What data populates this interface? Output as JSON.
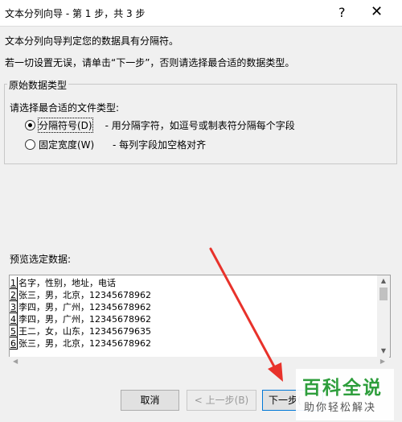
{
  "window": {
    "title": "文本分列向导 - 第 1 步，共 3 步",
    "help_label": "?",
    "close_label": "✕"
  },
  "description": {
    "line1": "文本分列向导判定您的数据具有分隔符。",
    "line2": "若一切设置无误，请单击“下一步”，否则请选择最合适的数据类型。"
  },
  "data_type_group": {
    "legend": "原始数据类型",
    "prompt": "请选择最合适的文件类型:",
    "options": [
      {
        "label": "分隔符号(D)",
        "desc": "- 用分隔字符，如逗号或制表符分隔每个字段",
        "checked": true
      },
      {
        "label": "固定宽度(W)",
        "desc": "- 每列字段加空格对齐",
        "checked": false
      }
    ]
  },
  "preview": {
    "label": "预览选定数据:",
    "rows": [
      {
        "num": "1",
        "text": "名字，性别，地址，电话"
      },
      {
        "num": "2",
        "text": "张三，男，北京，12345678962"
      },
      {
        "num": "3",
        "text": "李四，男，广州，12345678962"
      },
      {
        "num": "4",
        "text": "李四，男，广州，12345678962"
      },
      {
        "num": "5",
        "text": "王二，女，山东，12345679635"
      },
      {
        "num": "6",
        "text": "张三，男，北京，12345678962"
      }
    ]
  },
  "buttons": {
    "cancel": "取消",
    "back": "< 上一步(B)",
    "next": "下一步("
  },
  "watermark": {
    "title": "百科全说",
    "subtitle": "助你轻松解决"
  },
  "colors": {
    "annotation_arrow": "#e8322b",
    "watermark_green": "#2e9e3c",
    "focus_blue": "#0078d7"
  }
}
